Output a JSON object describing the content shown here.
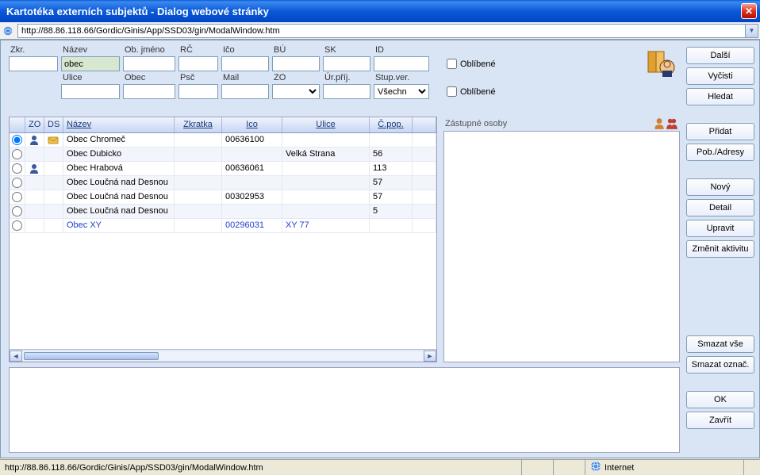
{
  "titlebar": {
    "title": "Kartotéka externích subjektů - Dialog webové stránky"
  },
  "url": "http://88.86.118.66/Gordic/Ginis/App/SSD03/gin/ModalWindow.htm",
  "search": {
    "row1": {
      "zkr": {
        "label": "Zkr.",
        "value": ""
      },
      "nazev": {
        "label": "Název",
        "value": "obec"
      },
      "objm": {
        "label": "Ob. jméno",
        "value": ""
      },
      "rc": {
        "label": "RČ",
        "value": ""
      },
      "ico": {
        "label": "Ičo",
        "value": ""
      },
      "bu": {
        "label": "BÚ",
        "value": ""
      },
      "sk": {
        "label": "SK",
        "value": ""
      },
      "id": {
        "label": "ID",
        "value": ""
      },
      "oblibene1": "Oblíbené"
    },
    "row2": {
      "ulice": {
        "label": "Ulice",
        "value": ""
      },
      "obec": {
        "label": "Obec",
        "value": ""
      },
      "psc": {
        "label": "Psč",
        "value": ""
      },
      "mail": {
        "label": "Mail",
        "value": ""
      },
      "zo": {
        "label": "ZO",
        "value": ""
      },
      "urpri": {
        "label": "Úr.příj.",
        "value": ""
      },
      "stupver": {
        "label": "Stup.ver.",
        "value": "Všechn"
      },
      "oblibene2": "Oblíbené"
    }
  },
  "grid": {
    "headers": {
      "radio": "",
      "zo": "ZO",
      "ds": "DS",
      "nazev": "Název",
      "zkratka": "Zkratka",
      "ico": "Ico",
      "ulice": "Ulice",
      "cpop": "Č.pop.",
      "last": ""
    },
    "rows": [
      {
        "selected": true,
        "hasPerson": true,
        "hasDs": true,
        "nazev": "Obec Chromeč",
        "zkratka": "",
        "ico": "00636100",
        "ulice": "",
        "cpop": "",
        "special": false
      },
      {
        "selected": false,
        "hasPerson": false,
        "hasDs": false,
        "nazev": "Obec Dubicko",
        "zkratka": "",
        "ico": "",
        "ulice": "Velká Strana",
        "cpop": "56",
        "special": false
      },
      {
        "selected": false,
        "hasPerson": true,
        "hasDs": false,
        "nazev": "Obec Hrabová",
        "zkratka": "",
        "ico": "00636061",
        "ulice": "",
        "cpop": "113",
        "special": false
      },
      {
        "selected": false,
        "hasPerson": false,
        "hasDs": false,
        "nazev": "Obec Loučná nad Desnou",
        "zkratka": "",
        "ico": "",
        "ulice": "",
        "cpop": "57",
        "special": false
      },
      {
        "selected": false,
        "hasPerson": false,
        "hasDs": false,
        "nazev": "Obec Loučná nad Desnou",
        "zkratka": "",
        "ico": "00302953",
        "ulice": "",
        "cpop": "57",
        "special": false
      },
      {
        "selected": false,
        "hasPerson": false,
        "hasDs": false,
        "nazev": "Obec Loučná nad Desnou",
        "zkratka": "",
        "ico": "",
        "ulice": "",
        "cpop": "5",
        "special": false
      },
      {
        "selected": false,
        "hasPerson": false,
        "hasDs": false,
        "nazev": "Obec XY",
        "zkratka": "",
        "ico": "00296031",
        "ulice": "XY 77",
        "cpop": "",
        "special": true
      }
    ]
  },
  "rightPanel": {
    "title": "Zástupné osoby"
  },
  "buttons": {
    "dalsi": "Další",
    "vycisti": "Vyčisti",
    "hledat": "Hledat",
    "pridat": "Přidat",
    "pobadresy": "Pob./Adresy",
    "novy": "Nový",
    "detail": "Detail",
    "upravit": "Upravit",
    "zmenitakt": "Změnit aktivitu",
    "smazatvse": "Smazat vše",
    "smazatoznac": "Smazat označ.",
    "ok": "OK",
    "zavrit": "Zavřít"
  },
  "status": {
    "url": "http://88.86.118.66/Gordic/Ginis/App/SSD03/gin/ModalWindow.htm",
    "zone": "Internet"
  }
}
